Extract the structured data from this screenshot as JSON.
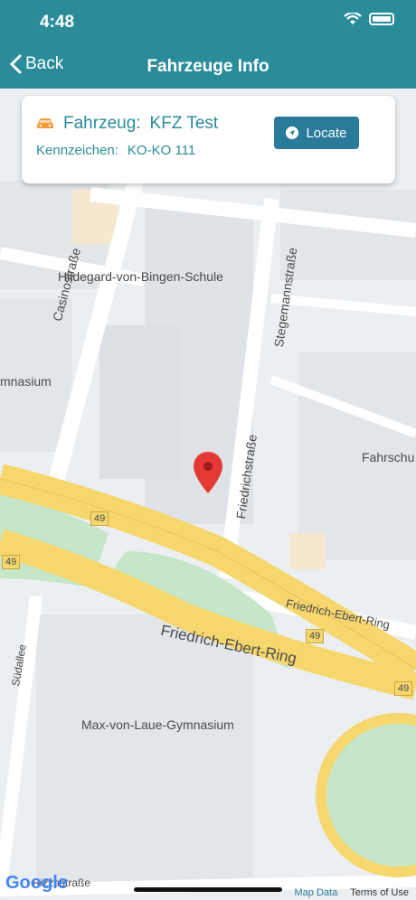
{
  "status_bar": {
    "time": "4:48"
  },
  "nav": {
    "back_label": "Back",
    "title": "Fahrzeuge Info"
  },
  "card": {
    "vehicle_label": "Fahrzeug:",
    "vehicle_name": "KFZ Test",
    "plate_label": "Kennzeichen:",
    "plate_value": "KO-KO 111",
    "locate_label": "Locate"
  },
  "map": {
    "labels": {
      "school1": "Hildegard-von-Bingen-Schule",
      "gymnasium_partial": "mnasium",
      "street_casino": "Casinostraße",
      "street_stegemann": "Stegemannstraße",
      "street_friedrich": "Friedrichstraße",
      "fahrschule_partial": "Fahrschu",
      "ring_small": "Friedrich-Ebert-Ring",
      "ring_big": "Friedrich-Ebert-Ring",
      "street_sued": "Südallee",
      "school2": "Max-von-Laue-Gymnasium",
      "street_rizza": "Rizzastraße",
      "route_49": "49"
    },
    "google": "Google",
    "map_data": "Map Data",
    "terms": "Terms of Use"
  },
  "colors": {
    "header": "#2a8c99",
    "button": "#2a7a9a",
    "road_major": "#f5d76e",
    "park": "#c6e6c9",
    "pin": "#e53935"
  }
}
